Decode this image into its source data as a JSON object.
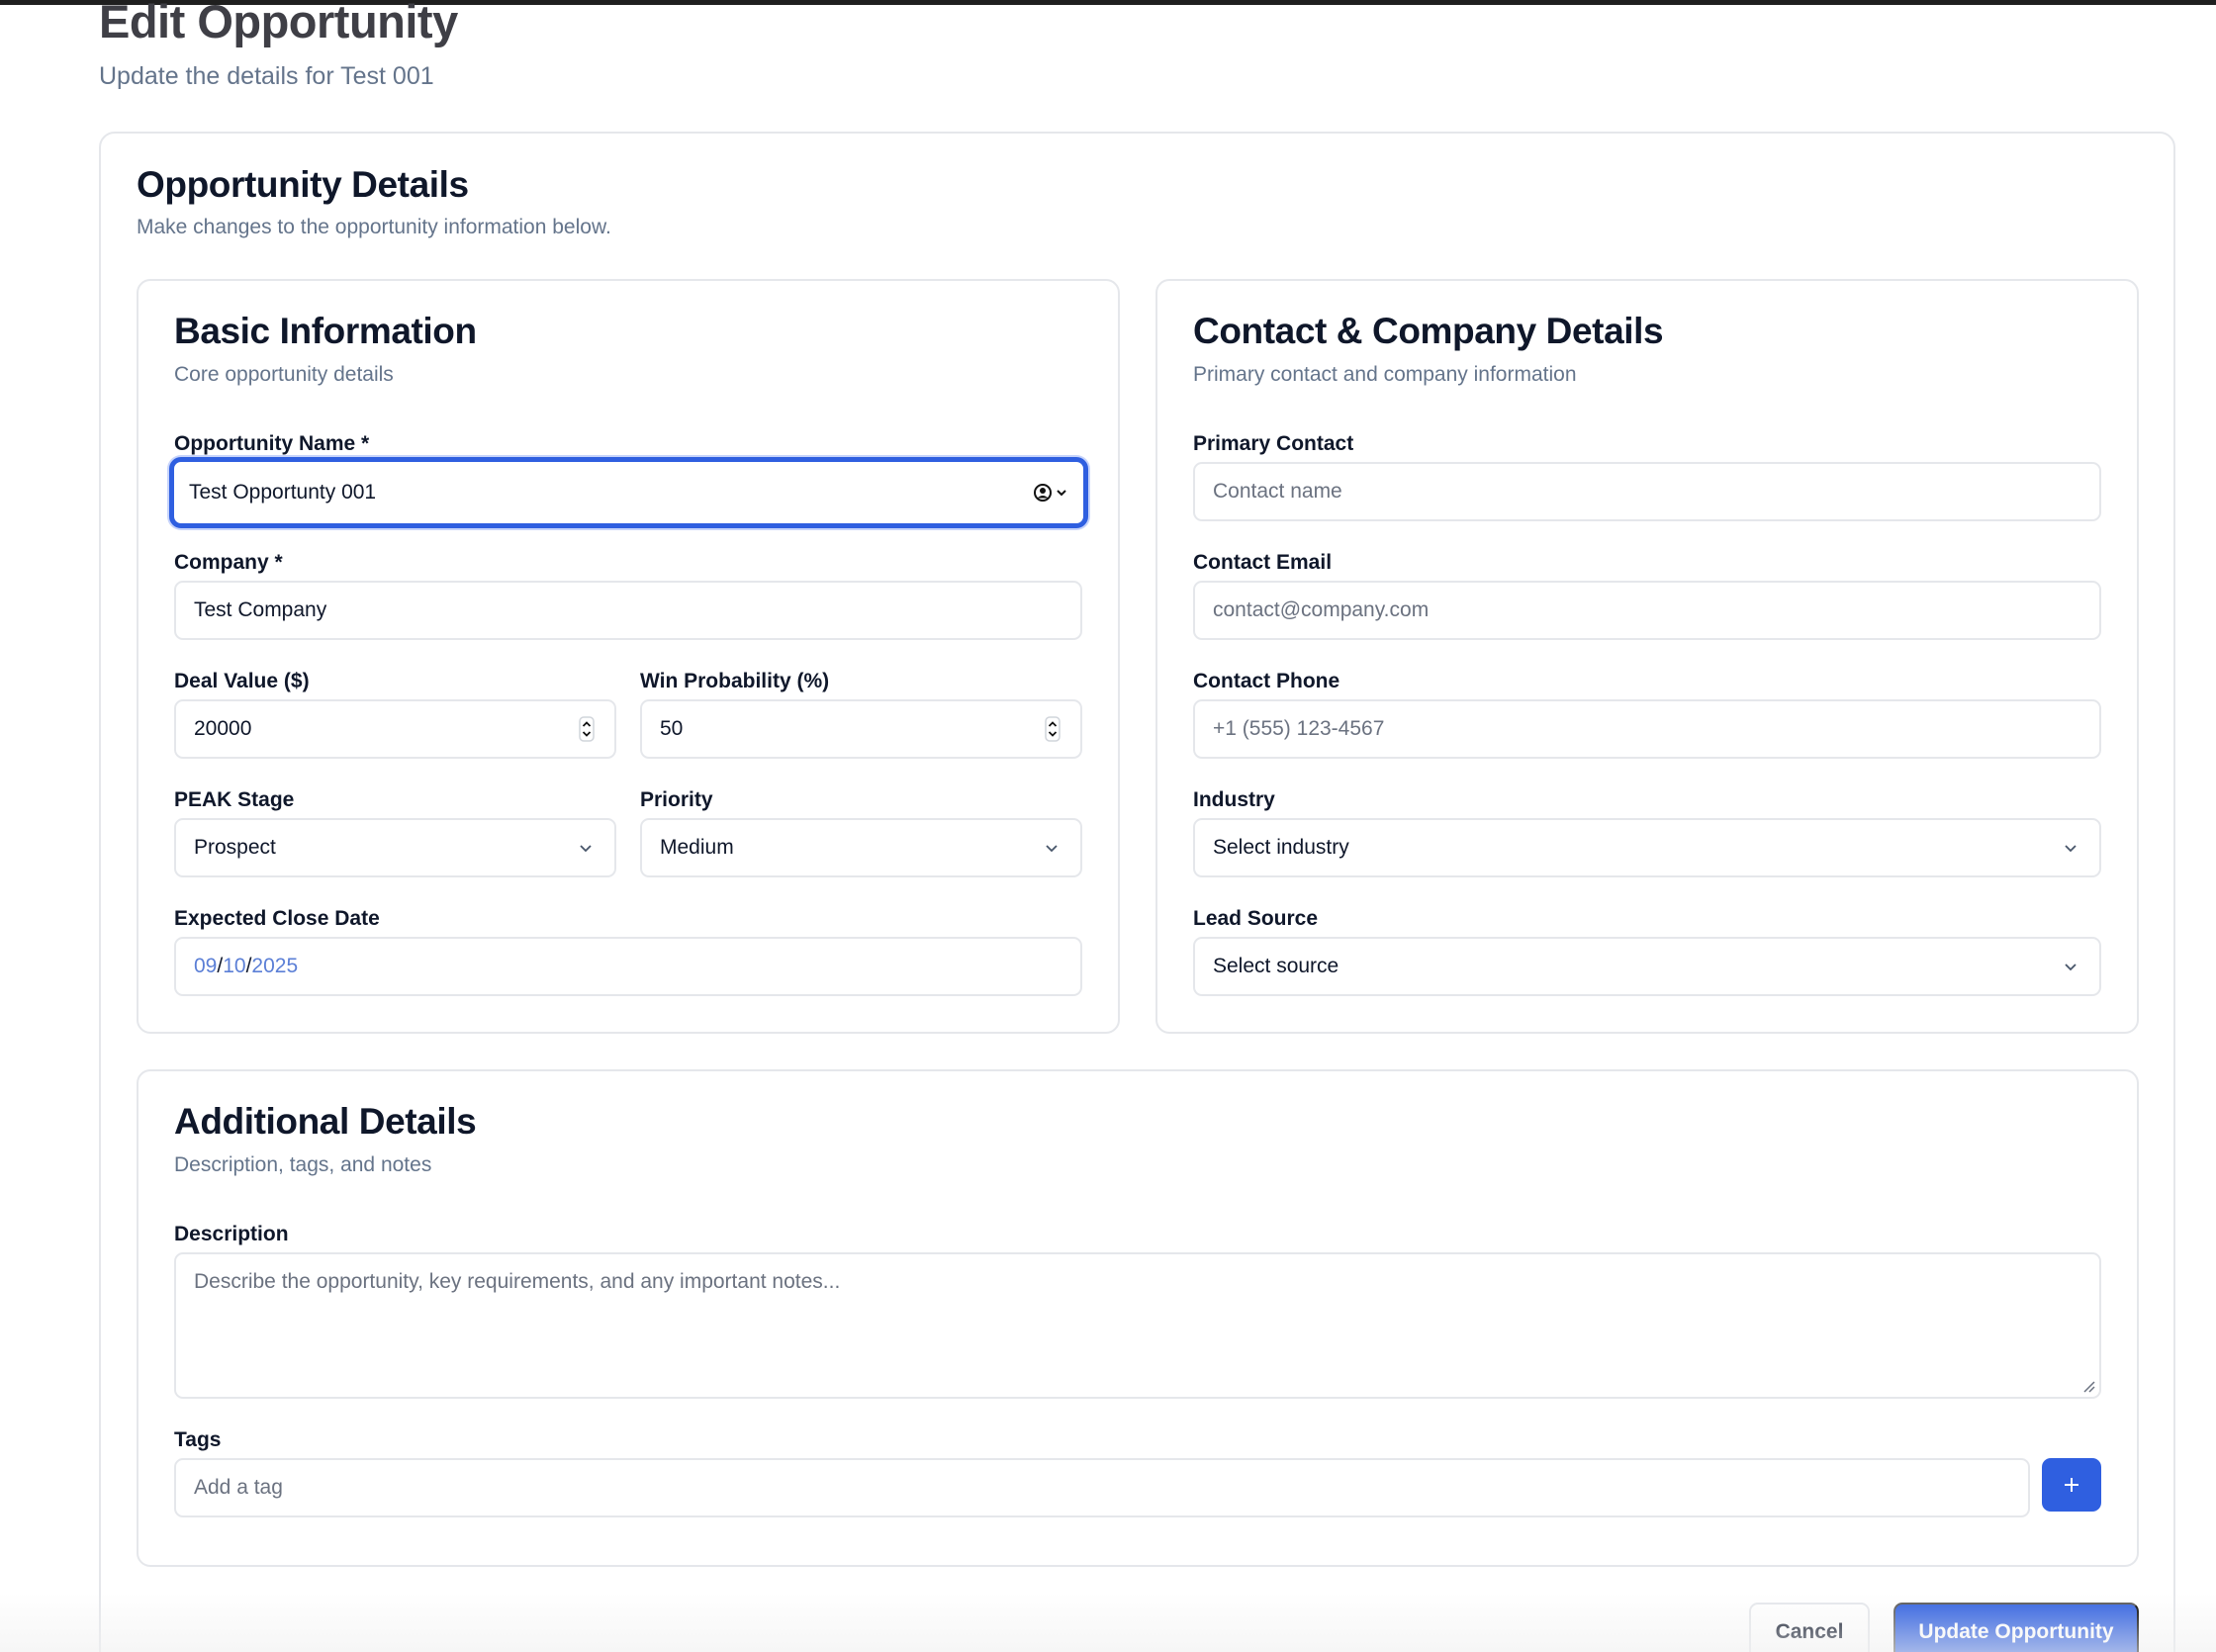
{
  "header": {
    "title": "Edit Opportunity",
    "subtitle": "Update the details for Test 001"
  },
  "form": {
    "title": "Opportunity Details",
    "description": "Make changes to the opportunity information below.",
    "basic": {
      "title": "Basic Information",
      "description": "Core opportunity details",
      "opportunity_name": {
        "label": "Opportunity Name *",
        "value": "Test Opportunty 001"
      },
      "company": {
        "label": "Company *",
        "value": "Test Company"
      },
      "deal_value": {
        "label": "Deal Value ($)",
        "value": "20000"
      },
      "win_probability": {
        "label": "Win Probability (%)",
        "value": "50"
      },
      "peak_stage": {
        "label": "PEAK Stage",
        "value": "Prospect"
      },
      "priority": {
        "label": "Priority",
        "value": "Medium"
      },
      "close_date": {
        "label": "Expected Close Date",
        "month": "09",
        "day": "10",
        "year": "2025",
        "sep": "/"
      }
    },
    "contact": {
      "title": "Contact & Company Details",
      "description": "Primary contact and company information",
      "primary_contact": {
        "label": "Primary Contact",
        "placeholder": "Contact name"
      },
      "contact_email": {
        "label": "Contact Email",
        "placeholder": "contact@company.com"
      },
      "contact_phone": {
        "label": "Contact Phone",
        "placeholder": "+1 (555) 123-4567"
      },
      "industry": {
        "label": "Industry",
        "value": "Select industry"
      },
      "lead_source": {
        "label": "Lead Source",
        "value": "Select source"
      }
    },
    "additional": {
      "title": "Additional Details",
      "description": "Description, tags, and notes",
      "description_field": {
        "label": "Description",
        "placeholder": "Describe the opportunity, key requirements, and any important notes..."
      },
      "tags": {
        "label": "Tags",
        "placeholder": "Add a tag"
      }
    }
  },
  "actions": {
    "cancel_label": "Cancel",
    "update_label": "Update Opportunity"
  },
  "icons": {
    "chevron": "chevron-down-icon",
    "spinner": "number-spinner-icon",
    "contact": "contact-autofill-icon",
    "add": "plus-icon",
    "resize": "resize-grip-icon"
  },
  "colors": {
    "primary": "#2f5fe0",
    "focus_ring": "#2f5fe0",
    "border": "#e5e7eb",
    "muted_text": "#64748b",
    "date_accent": "#5b7fd6"
  }
}
